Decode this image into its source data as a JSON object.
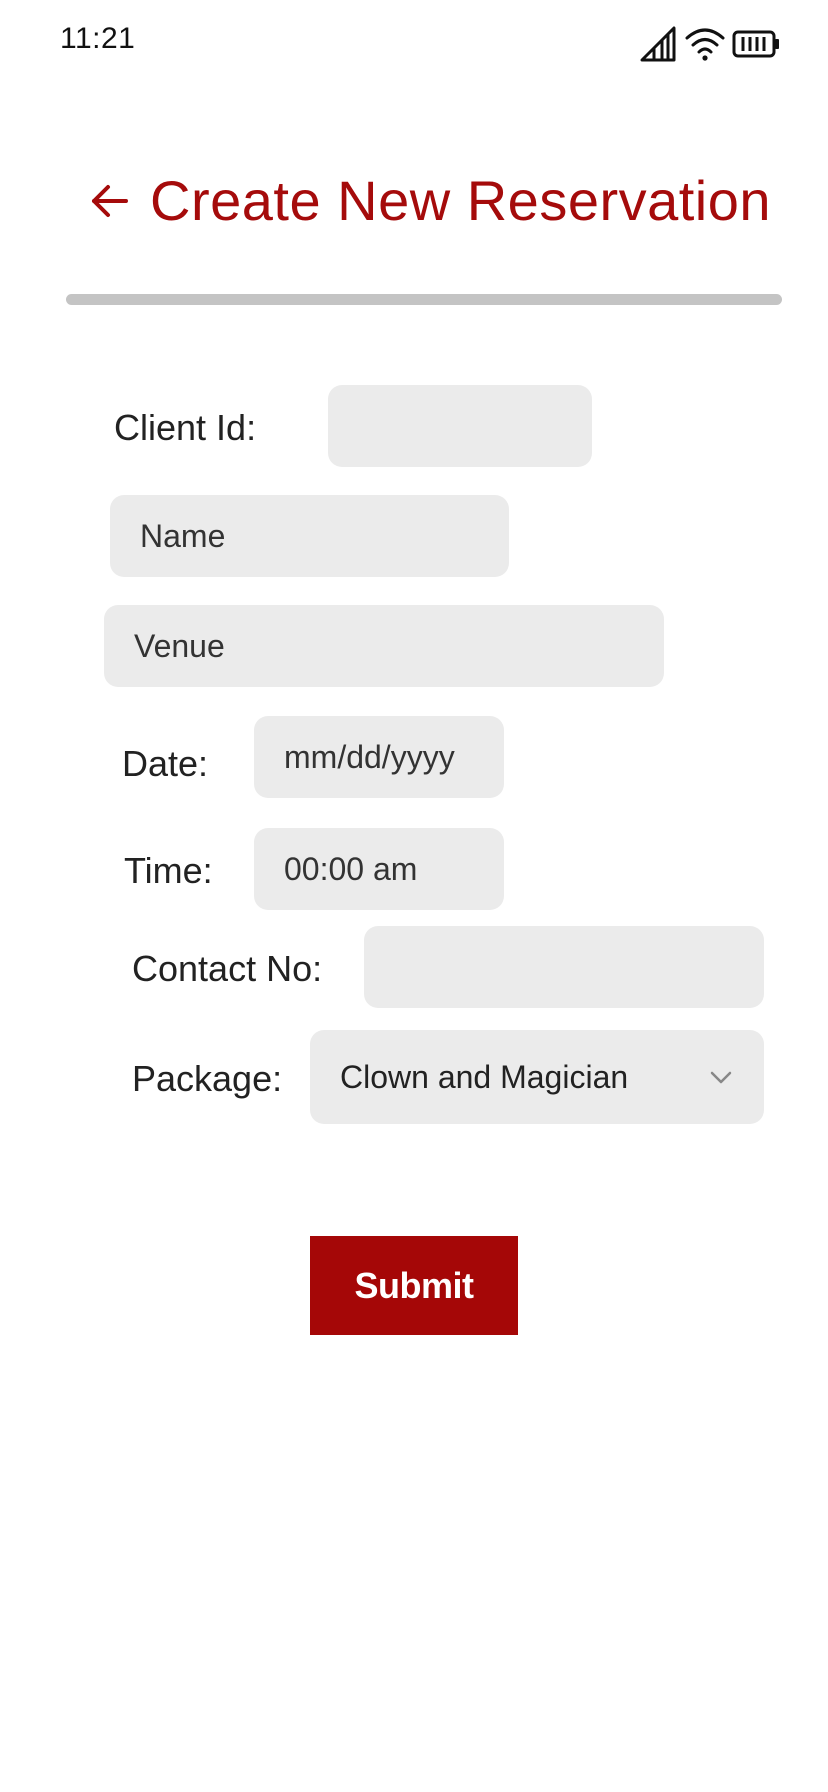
{
  "status_bar": {
    "time": "11:21",
    "icons": [
      "signal-icon",
      "wifi-icon",
      "battery-icon"
    ]
  },
  "header": {
    "back_icon": "arrow-left-icon",
    "title": "Create New Reservation"
  },
  "form": {
    "client_id": {
      "label": "Client Id:",
      "value": ""
    },
    "name": {
      "placeholder": "Name",
      "value": ""
    },
    "venue": {
      "placeholder": "Venue",
      "value": ""
    },
    "date": {
      "label": "Date:",
      "placeholder": "mm/dd/yyyy",
      "value": ""
    },
    "time": {
      "label": "Time:",
      "placeholder": "00:00 am",
      "value": ""
    },
    "contact": {
      "label": "Contact No:",
      "value": ""
    },
    "package": {
      "label": "Package:",
      "selected": "Clown and Magician",
      "icon": "chevron-down-icon"
    },
    "submit_label": "Submit"
  },
  "colors": {
    "accent": "#a50b0b",
    "button": "#a50707",
    "field_bg": "#ebebeb",
    "divider": "#c4c4c4"
  }
}
